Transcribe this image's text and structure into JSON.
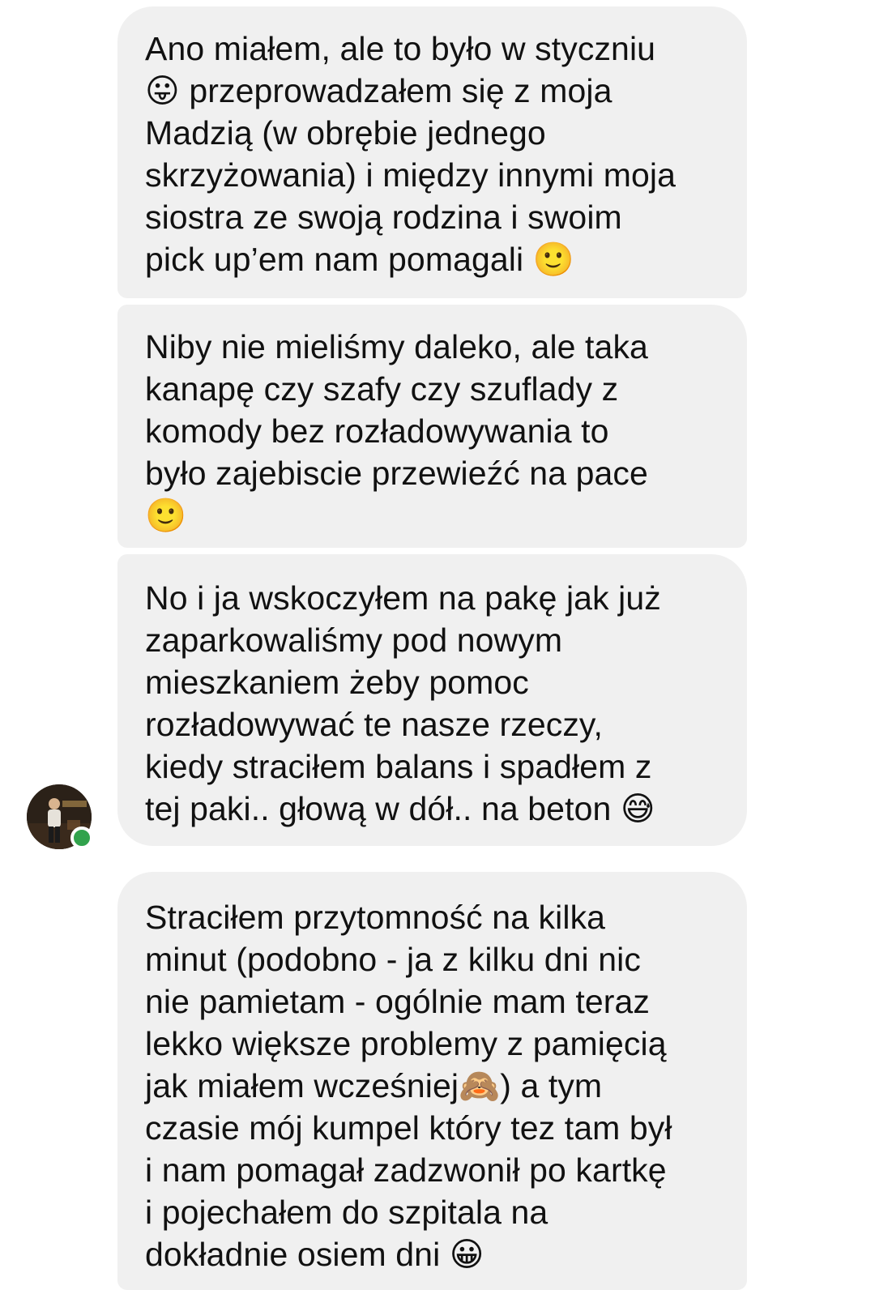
{
  "messages": [
    {
      "lines": [
        "Ano miałem, ale to było w styczniu",
        "😛 przeprowadzałem się z moja",
        "Madzią (w obrębie jednego",
        "skrzyżowania) i między innymi moja",
        "siostra ze swoją rodzina i swoim",
        "pick up’em nam pomagali 🙂"
      ]
    },
    {
      "lines": [
        "Niby nie mieliśmy daleko, ale taka",
        "kanapę czy szafy czy szuflady z",
        "komody bez rozładowywania to",
        "było zajebiscie przewieźć na pace",
        "🙂"
      ]
    },
    {
      "lines": [
        "No i ja wskoczyłem na pakę jak już",
        "zaparkowaliśmy pod nowym",
        "mieszkaniem żeby pomoc",
        "rozładowywać te nasze rzeczy,",
        "kiedy straciłem balans i spadłem z",
        "tej paki.. głową w dół.. na beton 😅"
      ]
    },
    {
      "lines": [
        "Straciłem przytomność na kilka",
        "minut (podobno - ja z kilku dni nic",
        "nie pamietam - ogólnie mam teraz",
        "lekko większe problemy z pamięcią",
        "jak miałem wcześniej🙈) a tym",
        "czasie mój kumpel który tez tam był",
        "i nam pomagał zadzwonił po kartkę",
        "i pojechałem do szpitala na",
        "dokładnie osiem dni 😀"
      ]
    }
  ],
  "sender": {
    "avatar_icon": "contact-avatar-icon",
    "online": true,
    "presence_color": "#31a24c"
  },
  "colors": {
    "bubble_background": "#f0f0f0",
    "text": "#111111"
  }
}
